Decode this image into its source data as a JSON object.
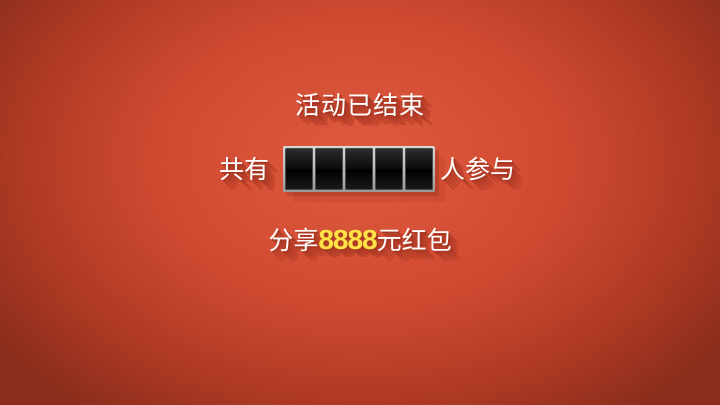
{
  "status_title": "活动已结束",
  "participants": {
    "prefix": "共有",
    "digits": [
      "",
      "",
      "",
      "",
      ""
    ],
    "suffix": "人参与"
  },
  "reward": {
    "prefix": "分享",
    "amount": "8888",
    "suffix": "元红包",
    "amount_color": "#ffe24a"
  },
  "colors": {
    "background": "#d24e33",
    "text": "#ffffff"
  }
}
